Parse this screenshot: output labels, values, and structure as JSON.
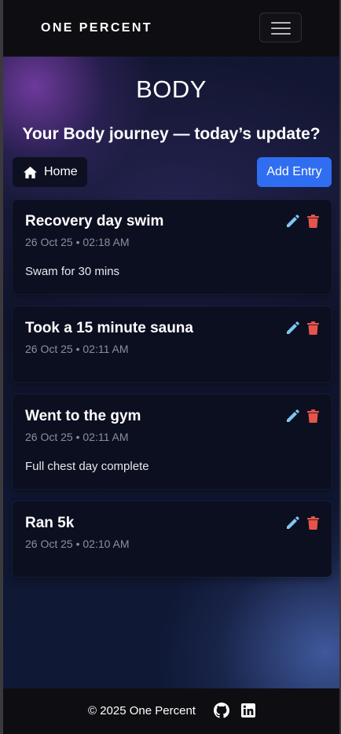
{
  "navbar": {
    "brand": "ONE PERCENT",
    "menu_icon": "hamburger-menu-icon"
  },
  "page": {
    "title": "BODY",
    "subtitle": "Your Body journey — today’s update?"
  },
  "actions": {
    "home_label": "Home",
    "home_icon": "home-icon",
    "add_entry_label": "Add Entry"
  },
  "entries": [
    {
      "title": "Recovery day swim",
      "timestamp": "26 Oct 25 • 02:18 AM",
      "body": "Swam for 30 mins"
    },
    {
      "title": "Took a 15 minute sauna",
      "timestamp": "26 Oct 25 • 02:11 AM",
      "body": ""
    },
    {
      "title": "Went to the gym",
      "timestamp": "26 Oct 25 • 02:11 AM",
      "body": "Full chest day complete"
    },
    {
      "title": "Ran 5k",
      "timestamp": "26 Oct 25 • 02:10 AM",
      "body": ""
    }
  ],
  "footer": {
    "copyright": "© 2025 One Percent",
    "icons": [
      "github-icon",
      "linkedin-icon"
    ]
  },
  "colors": {
    "accent": "#2f6ef0",
    "edit": "#7ec8f2",
    "delete": "#e5544a",
    "card_bg": "#0c0f20"
  }
}
